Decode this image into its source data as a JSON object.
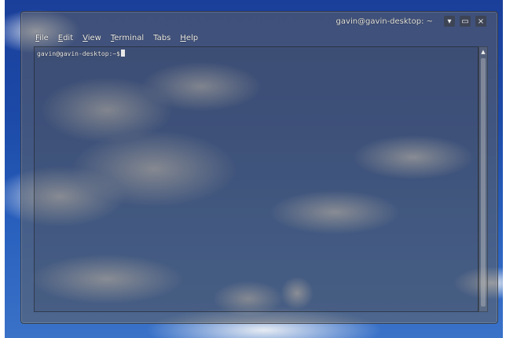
{
  "window": {
    "title": "gavin@gavin-desktop: ~",
    "buttons": {
      "minimize": "▾",
      "maximize": "▭",
      "close": "×"
    }
  },
  "menu": {
    "items": [
      {
        "mnemonic": "F",
        "rest": "ile"
      },
      {
        "mnemonic": "E",
        "rest": "dit"
      },
      {
        "mnemonic": "V",
        "rest": "iew"
      },
      {
        "mnemonic": "T",
        "rest": "erminal"
      },
      {
        "mnemonic": "",
        "rest": "Tabs"
      },
      {
        "mnemonic": "H",
        "rest": "elp"
      }
    ]
  },
  "terminal": {
    "prompt": "gavin@gavin-desktop:~$"
  },
  "icons": {
    "scroll_up": "▲"
  }
}
